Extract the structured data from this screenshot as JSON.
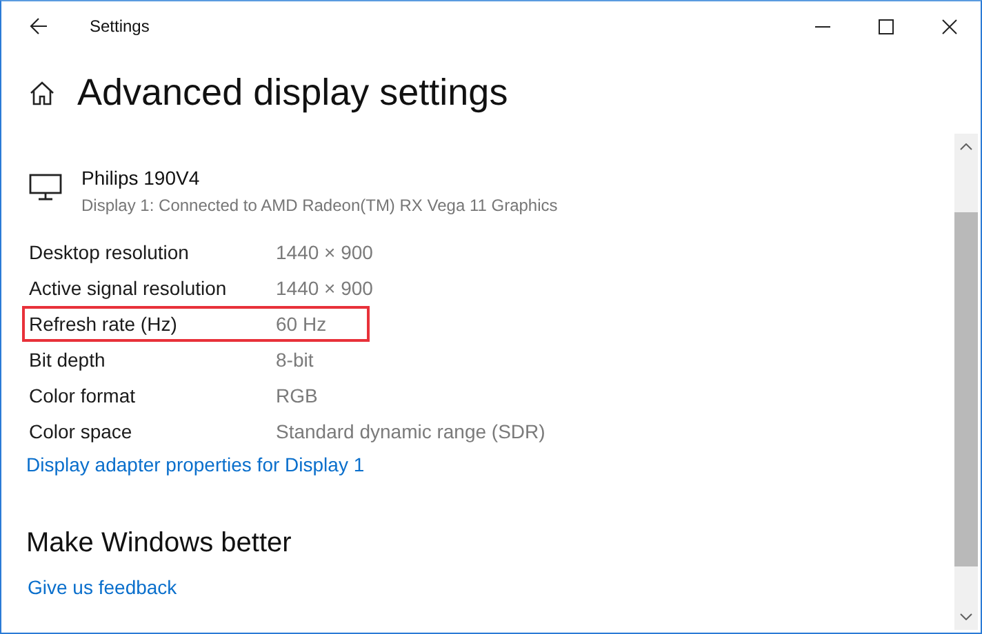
{
  "window": {
    "title": "Settings"
  },
  "page_title": "Advanced display settings",
  "display": {
    "name": "Philips 190V4",
    "description": "Display 1: Connected to AMD Radeon(TM) RX Vega 11 Graphics"
  },
  "specs": [
    {
      "label": "Desktop resolution",
      "value": "1440 × 900",
      "highlighted": false
    },
    {
      "label": "Active signal resolution",
      "value": "1440 × 900",
      "highlighted": false
    },
    {
      "label": "Refresh rate (Hz)",
      "value": "60 Hz",
      "highlighted": true
    },
    {
      "label": "Bit depth",
      "value": "8-bit",
      "highlighted": false
    },
    {
      "label": "Color format",
      "value": "RGB",
      "highlighted": false
    },
    {
      "label": "Color space",
      "value": "Standard dynamic range (SDR)",
      "highlighted": false
    }
  ],
  "adapter_link": "Display adapter properties for Display 1",
  "section": {
    "title": "Make Windows better",
    "link": "Give us feedback"
  }
}
